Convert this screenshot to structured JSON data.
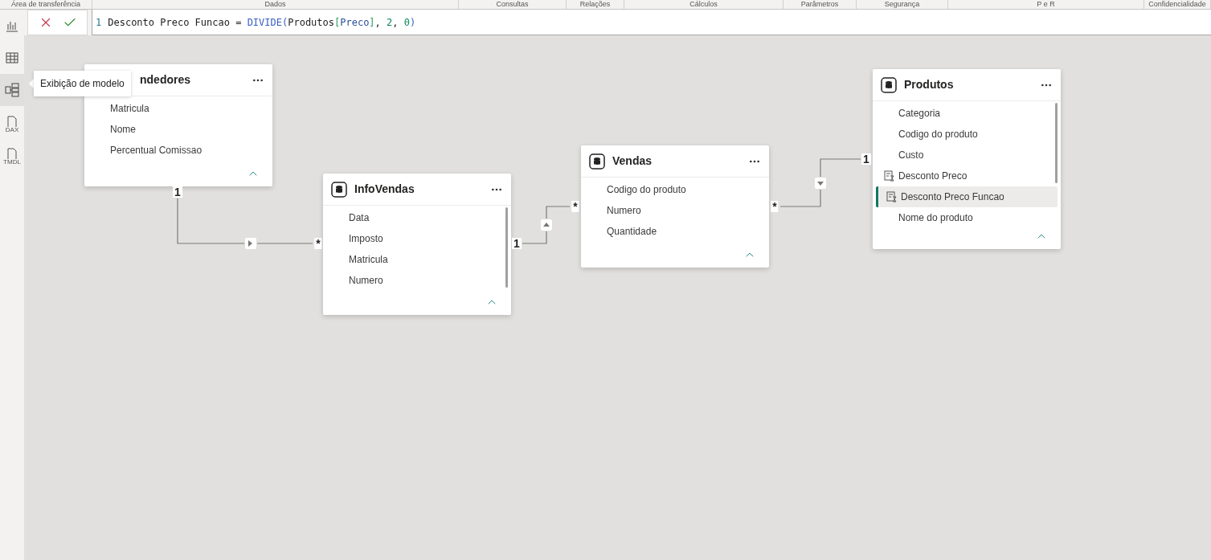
{
  "ribbon_groups": [
    "Área de transferência",
    "Dados",
    "Consultas",
    "Relações",
    "Cálculos",
    "Parâmetros",
    "Segurança",
    "P e R",
    "Confidencialidade"
  ],
  "formula_bar": {
    "line_number": "1",
    "tokens": [
      {
        "text": "Desconto Preco Funcao = ",
        "kind": "plain"
      },
      {
        "text": "DIVIDE(",
        "kind": "function"
      },
      {
        "text": "Produtos",
        "kind": "plain"
      },
      {
        "text": "[",
        "kind": "bracket"
      },
      {
        "text": "Preco",
        "kind": "column"
      },
      {
        "text": "]",
        "kind": "bracket"
      },
      {
        "text": ", ",
        "kind": "plain"
      },
      {
        "text": "2",
        "kind": "number"
      },
      {
        "text": ", ",
        "kind": "plain"
      },
      {
        "text": "0",
        "kind": "number"
      },
      {
        "text": ")",
        "kind": "function"
      }
    ]
  },
  "sidebar": {
    "items": [
      {
        "kind": "report",
        "selected": false
      },
      {
        "kind": "table",
        "selected": false
      },
      {
        "kind": "model",
        "selected": true
      },
      {
        "kind": "file",
        "label": "DAX",
        "selected": false
      },
      {
        "kind": "file",
        "label": "TMDL",
        "selected": false
      }
    ]
  },
  "tooltip": "Exibição de modelo",
  "tables": [
    {
      "title": "ndedores",
      "icon_visible": false,
      "fields": [
        {
          "name": "Matricula",
          "kind": "column",
          "selected": false
        },
        {
          "name": "Nome",
          "kind": "column",
          "selected": false
        },
        {
          "name": "Percentual Comissao",
          "kind": "column",
          "selected": false
        }
      ]
    },
    {
      "title": "InfoVendas",
      "icon_visible": true,
      "fields": [
        {
          "name": "Data",
          "kind": "column",
          "selected": false
        },
        {
          "name": "Imposto",
          "kind": "column",
          "selected": false
        },
        {
          "name": "Matricula",
          "kind": "column",
          "selected": false
        },
        {
          "name": "Numero",
          "kind": "column",
          "selected": false
        }
      ]
    },
    {
      "title": "Vendas",
      "icon_visible": true,
      "fields": [
        {
          "name": "Codigo do produto",
          "kind": "column",
          "selected": false
        },
        {
          "name": "Numero",
          "kind": "column",
          "selected": false
        },
        {
          "name": "Quantidade",
          "kind": "column",
          "selected": false
        }
      ]
    },
    {
      "title": "Produtos",
      "icon_visible": true,
      "fields": [
        {
          "name": "Categoria",
          "kind": "column",
          "selected": false
        },
        {
          "name": "Codigo do produto",
          "kind": "column",
          "selected": false
        },
        {
          "name": "Custo",
          "kind": "column",
          "selected": false
        },
        {
          "name": "Desconto Preco",
          "kind": "measure",
          "selected": false
        },
        {
          "name": "Desconto Preco Funcao",
          "kind": "measure",
          "selected": true
        },
        {
          "name": "Nome do produto",
          "kind": "column",
          "selected": false
        }
      ]
    }
  ],
  "relationships": [
    {
      "from_label": "1",
      "to_label": "*",
      "kind": "right"
    },
    {
      "from_label": "1",
      "to_label": "*",
      "kind": "up"
    },
    {
      "from_label": "*",
      "to_label": "1",
      "kind": "down"
    }
  ]
}
